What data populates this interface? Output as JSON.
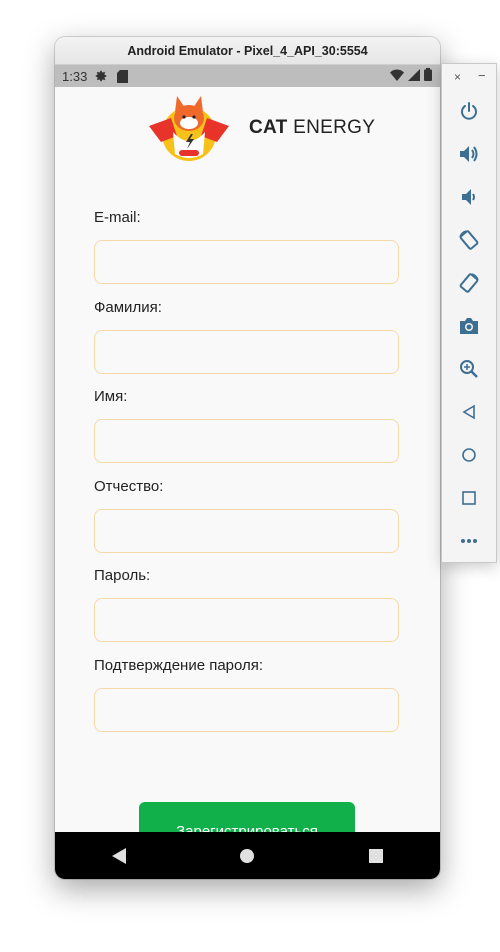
{
  "window": {
    "title": "Android Emulator - Pixel_4_API_30:5554"
  },
  "status_bar": {
    "time": "1:33",
    "icons": [
      "settings-icon",
      "sd-card-icon",
      "wifi-icon",
      "signal-icon",
      "battery-icon"
    ]
  },
  "app": {
    "logo": {
      "brand_bold": "CAT",
      "brand_light": "ENERGY"
    },
    "form": {
      "fields": [
        {
          "label": "E-mail:",
          "value": ""
        },
        {
          "label": "Фамилия:",
          "value": ""
        },
        {
          "label": "Имя:",
          "value": ""
        },
        {
          "label": "Отчество:",
          "value": ""
        },
        {
          "label": "Пароль:",
          "value": ""
        },
        {
          "label": "Подтверждение пароля:",
          "value": ""
        }
      ],
      "submit_label": "Зарегистрироваться"
    }
  },
  "nav_bar": {
    "buttons": [
      "back-icon",
      "home-icon",
      "recents-icon"
    ]
  },
  "toolbar": {
    "close": "×",
    "minimize": "−",
    "buttons": [
      "power-icon",
      "volume-up-icon",
      "volume-down-icon",
      "rotate-left-icon",
      "rotate-right-icon",
      "camera-icon",
      "zoom-icon",
      "back-icon",
      "home-icon",
      "overview-icon",
      "more-icon"
    ]
  },
  "colors": {
    "accent_green": "#11b04a",
    "input_border": "#f7d9a7",
    "toolbar_icon": "#3d6f93"
  }
}
